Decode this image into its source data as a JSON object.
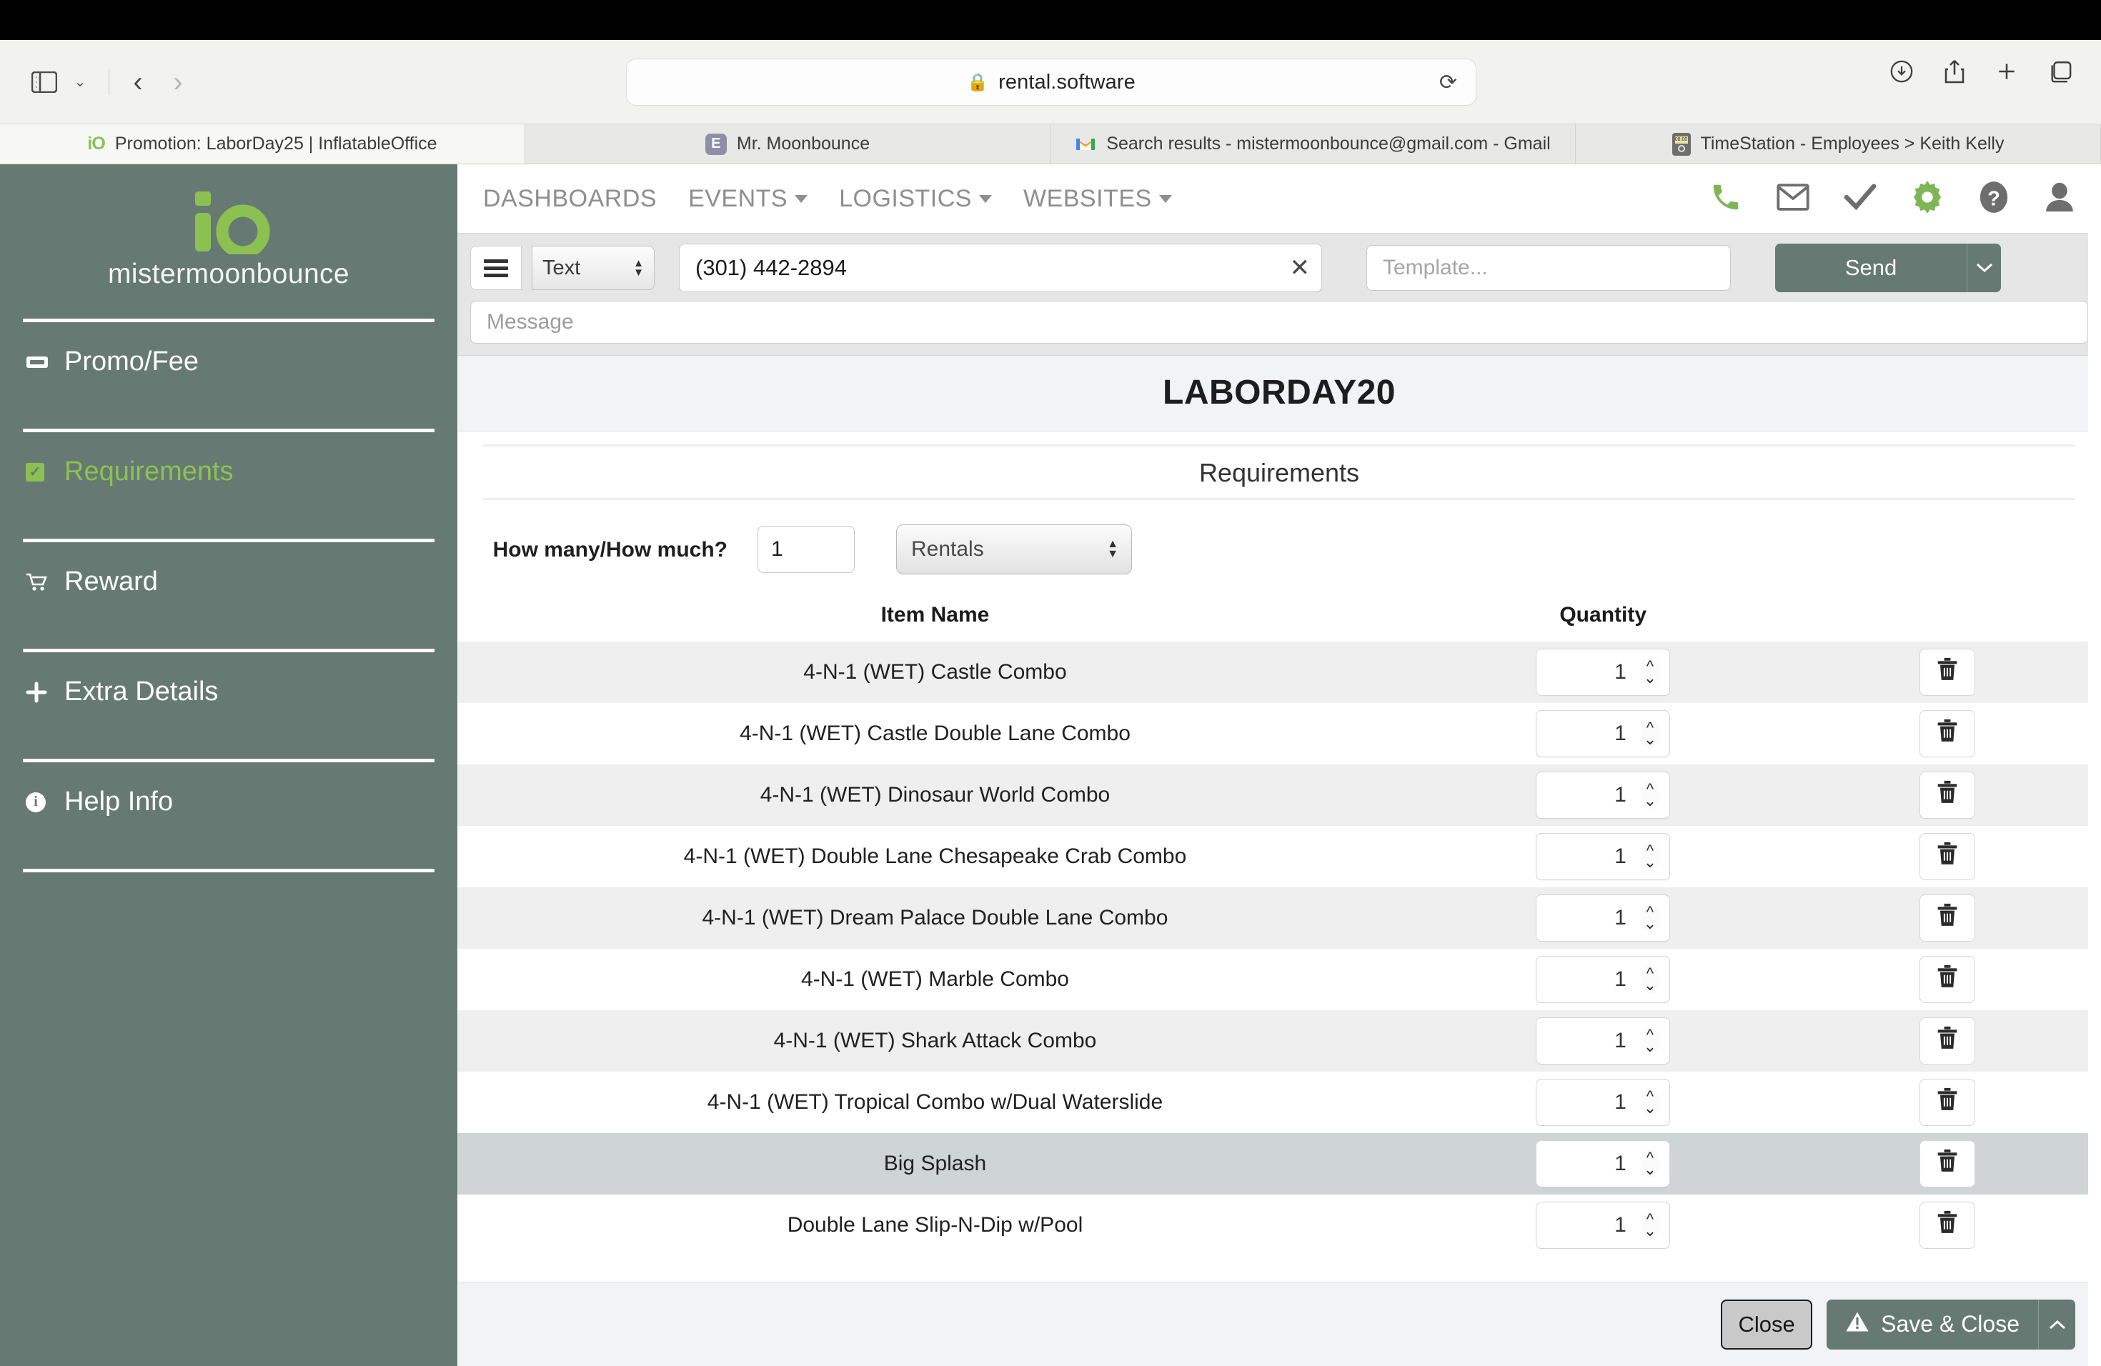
{
  "browser": {
    "url": "rental.software",
    "lock_icon": "lock-icon",
    "reload_icon": "reload-icon",
    "sidebar_toggle_icon": "sidebar-toggle-icon",
    "tabs_overview_icon": "chevron-down-icon",
    "back_icon": "back-chevron-icon",
    "forward_icon": "forward-chevron-icon",
    "downloads_icon": "downloads-icon",
    "share_icon": "share-icon",
    "new_tab_icon": "plus-icon",
    "tab_overview_icon": "tab-overview-icon",
    "tabs": [
      {
        "title": "Promotion: LaborDay25 | InflatableOffice",
        "favicon": "io-logo-icon",
        "active": true
      },
      {
        "title": "Mr. Moonbounce",
        "favicon": "evernote-icon",
        "active": false
      },
      {
        "title": "Search results - mistermoonbounce@gmail.com - Gmail",
        "favicon": "gmail-icon",
        "active": false
      },
      {
        "title": "TimeStation - Employees > Keith Kelly",
        "favicon": "timestation-icon",
        "active": false
      }
    ]
  },
  "sidebar": {
    "brand_logo": "io-logo",
    "brand_name": "mistermoonbounce",
    "items": [
      {
        "label": "Promo/Fee",
        "icon": "ticket-icon",
        "active": false
      },
      {
        "label": "Requirements",
        "icon": "checkbox-icon",
        "active": true
      },
      {
        "label": "Reward",
        "icon": "shopping-cart-icon",
        "active": false
      },
      {
        "label": "Extra Details",
        "icon": "plus-icon",
        "active": false
      },
      {
        "label": "Help Info",
        "icon": "info-icon",
        "active": false
      }
    ]
  },
  "topnav": {
    "links": [
      {
        "label": "DASHBOARDS",
        "has_caret": false
      },
      {
        "label": "EVENTS",
        "has_caret": true
      },
      {
        "label": "LOGISTICS",
        "has_caret": true
      },
      {
        "label": "WEBSITES",
        "has_caret": true
      }
    ],
    "icons": [
      {
        "name": "phone-icon",
        "color": "#7fb457"
      },
      {
        "name": "envelope-icon",
        "color": "#6e6e6e"
      },
      {
        "name": "check-icon",
        "color": "#6e6e6e"
      },
      {
        "name": "gear-icon",
        "color": "#7fb457"
      },
      {
        "name": "help-icon",
        "color": "#6e6e6e"
      },
      {
        "name": "user-icon",
        "color": "#6e6e6e"
      }
    ]
  },
  "messagebar": {
    "menu_icon": "hamburger-icon",
    "type_value": "Text",
    "phone_value": "(301) 442-2894",
    "clear_icon": "close-x-icon",
    "template_placeholder": "Template...",
    "send_label": "Send",
    "send_caret_icon": "caret-down-icon",
    "message_placeholder": "Message"
  },
  "page": {
    "title": "LABORDAY20",
    "section_title": "Requirements",
    "howmany_label": "How many/How much?",
    "howmany_value": "1",
    "category_value": "Rentals"
  },
  "table": {
    "columns": [
      "Item Name",
      "Quantity",
      ""
    ],
    "delete_icon": "trash-icon",
    "rows": [
      {
        "name": "4-N-1 (WET) Castle Combo",
        "qty": "1",
        "shade": "alt"
      },
      {
        "name": "4-N-1 (WET) Castle Double Lane Combo",
        "qty": "1",
        "shade": ""
      },
      {
        "name": "4-N-1 (WET) Dinosaur World Combo",
        "qty": "1",
        "shade": "alt"
      },
      {
        "name": "4-N-1 (WET) Double Lane Chesapeake Crab Combo",
        "qty": "1",
        "shade": ""
      },
      {
        "name": "4-N-1 (WET) Dream Palace Double Lane Combo",
        "qty": "1",
        "shade": "alt"
      },
      {
        "name": "4-N-1 (WET) Marble Combo",
        "qty": "1",
        "shade": ""
      },
      {
        "name": "4-N-1 (WET) Shark Attack Combo",
        "qty": "1",
        "shade": "alt"
      },
      {
        "name": "4-N-1 (WET) Tropical Combo w/Dual Waterslide",
        "qty": "1",
        "shade": ""
      },
      {
        "name": "Big Splash",
        "qty": "1",
        "shade": "hover"
      },
      {
        "name": "Double Lane Slip-N-Dip w/Pool",
        "qty": "1",
        "shade": ""
      }
    ]
  },
  "footer": {
    "close_label": "Close",
    "save_label": "Save & Close",
    "save_warning_icon": "warning-triangle-icon",
    "save_caret_icon": "caret-up-icon"
  },
  "colors": {
    "brand_green": "#8cc152",
    "sidebar_bg": "#667a73",
    "accent_button": "#667a73"
  }
}
